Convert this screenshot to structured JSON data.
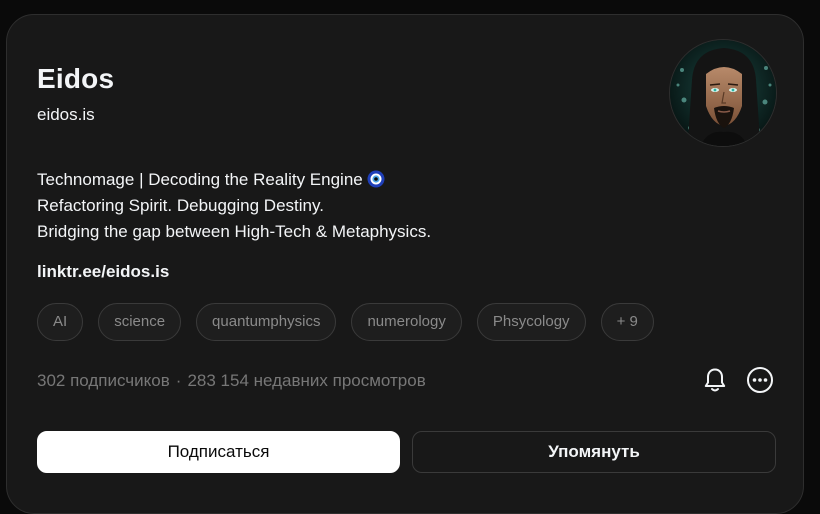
{
  "profile": {
    "name": "Eidos",
    "handle": "eidos.is",
    "bio": [
      "Technomage | Decoding the Reality Engine",
      "Refactoring Spirit. Debugging Destiny.",
      "Bridging the gap between High-Tech & Metaphysics."
    ],
    "bio_emoji_icon": "nazar-amulet-icon",
    "link": "linktr.ee/eidos.is",
    "avatar_icon": "profile-photo"
  },
  "tags": [
    "AI",
    "science",
    "quantumphysics",
    "numerology",
    "Phsycology",
    "+ 9"
  ],
  "stats": {
    "followers": "302 подписчиков",
    "separator": "·",
    "views": "283 154 недавних просмотров"
  },
  "actions": {
    "bell_icon": "bell-icon",
    "more_icon": "more-options-icon",
    "follow_label": "Подписаться",
    "mention_label": "Упомянуть"
  },
  "colors": {
    "background": "#0a0a0a",
    "card": "#181818",
    "border": "#2e2e2e",
    "muted_text": "#777777",
    "tag_text": "#8a8a8a",
    "primary_button": "#ffffff"
  }
}
